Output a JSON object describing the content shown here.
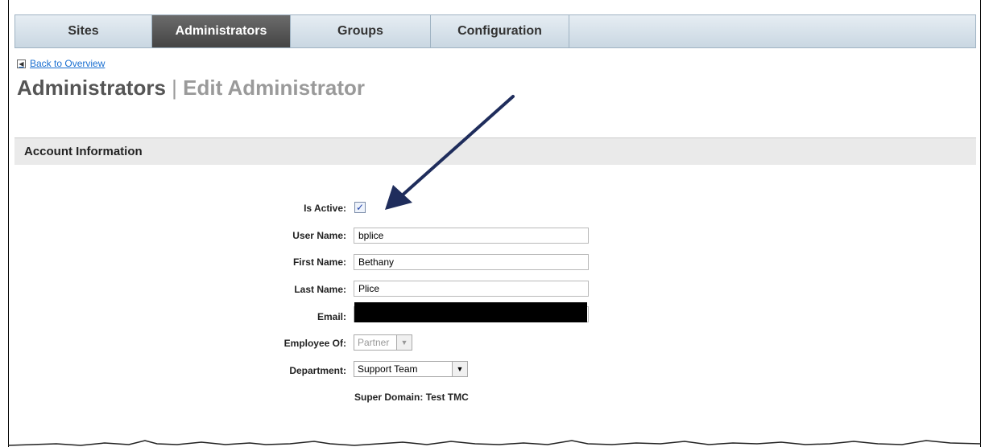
{
  "tabs": [
    {
      "label": "Sites",
      "active": false
    },
    {
      "label": "Administrators",
      "active": true
    },
    {
      "label": "Groups",
      "active": false
    },
    {
      "label": "Configuration",
      "active": false
    }
  ],
  "back_link": "Back to Overview",
  "page_title": {
    "main": "Administrators",
    "separator": "|",
    "sub": "Edit Administrator"
  },
  "section_title": "Account Information",
  "form": {
    "is_active": {
      "label": "Is Active:",
      "checked": true
    },
    "user_name": {
      "label": "User Name:",
      "value": "bplice"
    },
    "first_name": {
      "label": "First Name:",
      "value": "Bethany"
    },
    "last_name": {
      "label": "Last Name:",
      "value": "Plice"
    },
    "email": {
      "label": "Email:"
    },
    "employee_of": {
      "label": "Employee Of:",
      "value": "Partner"
    },
    "department": {
      "label": "Department:",
      "value": "Support Team"
    },
    "super_domain": {
      "label": "Super Domain:",
      "value": "Test TMC"
    }
  },
  "icons": {
    "back": "back-arrow-icon",
    "dropdown": "chevron-down-icon",
    "check": "checkmark-icon"
  },
  "colors": {
    "active_tab": "#555555",
    "annotation_arrow": "#1f2d5c",
    "link": "#1a6fd1"
  }
}
